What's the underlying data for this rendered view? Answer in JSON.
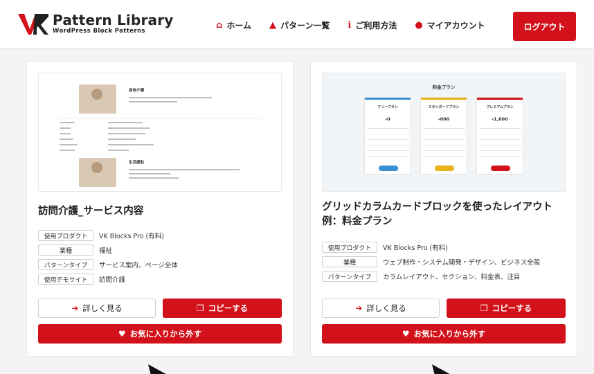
{
  "header": {
    "logo_title": "Pattern Library",
    "logo_subtitle": "WordPress Block Patterns",
    "nav": [
      {
        "label": "ホーム",
        "icon": "home-icon",
        "glyph": "⌂"
      },
      {
        "label": "パターン一覧",
        "icon": "shapes-icon",
        "glyph": "▲"
      },
      {
        "label": "ご利用方法",
        "icon": "info-icon",
        "glyph": "i"
      },
      {
        "label": "マイアカウント",
        "icon": "user-icon",
        "glyph": "●"
      }
    ],
    "logout_label": "ログアウト"
  },
  "colors": {
    "accent": "#d3111a",
    "background": "#f4f4f4",
    "card": "#ffffff"
  },
  "cards": [
    {
      "title": "訪問介護_サービス内容",
      "thumbnail": {
        "heading_1": "身体介護",
        "heading_2": "生活援助"
      },
      "meta": [
        {
          "key": "使用プロダクト",
          "value": "VK Blocks Pro (有料)"
        },
        {
          "key": "業種",
          "value": "福祉"
        },
        {
          "key": "パターンタイプ",
          "value": "サービス案内、ページ全体"
        },
        {
          "key": "使用デモサイト",
          "value": "訪問介護"
        }
      ],
      "detail_label": "詳しく見る",
      "copy_label": "コピーする",
      "favorite_label": "お気に入りから外す"
    },
    {
      "title": "グリッドカラムカードブロックを使ったレイアウト例：料金プラン",
      "thumbnail": {
        "heading": "料金プラン",
        "plans": [
          {
            "name": "フリープラン",
            "price": "0",
            "color": "#3a8fd1"
          },
          {
            "name": "スタンダードプラン",
            "price": "800",
            "color": "#e8b21a"
          },
          {
            "name": "プレミアムプラン",
            "price": "1,600",
            "color": "#d3111a"
          }
        ]
      },
      "meta": [
        {
          "key": "使用プロダクト",
          "value": "VK Blocks Pro (有料)"
        },
        {
          "key": "業種",
          "value": "ウェブ制作・システム開発・デザイン、ビジネス全般"
        },
        {
          "key": "パターンタイプ",
          "value": "カラムレイアウト、セクション、料金表、注目"
        }
      ],
      "detail_label": "詳しく見る",
      "copy_label": "コピーする",
      "favorite_label": "お気に入りから外す"
    }
  ]
}
